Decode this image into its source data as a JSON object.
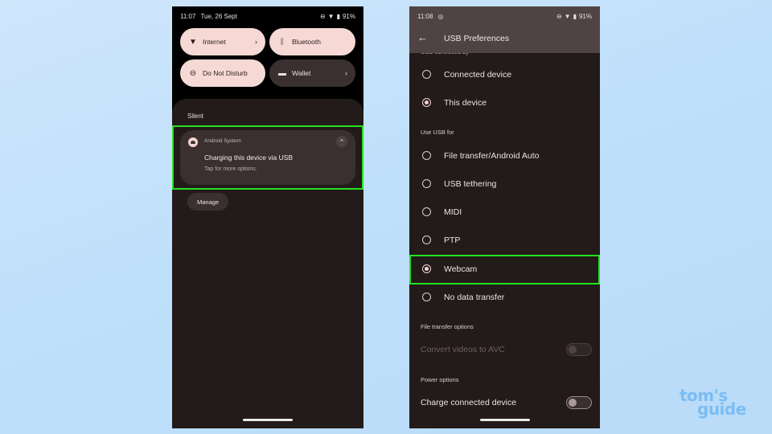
{
  "left_screen": {
    "status_bar": {
      "time": "11:07",
      "date": "Tue, 26 Sept",
      "battery": "91%",
      "icons": [
        "dnd-icon",
        "wifi-icon",
        "battery-icon"
      ]
    },
    "quick_tiles": [
      {
        "label": "Internet",
        "icon": "wifi-icon",
        "state": "on",
        "has_chevron": true
      },
      {
        "label": "Bluetooth",
        "icon": "bluetooth-icon",
        "state": "on",
        "has_chevron": false
      },
      {
        "label": "Do Not Disturb",
        "icon": "dnd-icon",
        "state": "on",
        "has_chevron": false
      },
      {
        "label": "Wallet",
        "icon": "wallet-icon",
        "state": "off",
        "has_chevron": true
      }
    ],
    "chevron": "›",
    "section_label": "Silent",
    "notification": {
      "app_name": "Android System",
      "title": "Charging this device via USB",
      "subtitle": "Tap for more options.",
      "expand_icon": "^"
    },
    "manage_label": "Manage"
  },
  "right_screen": {
    "status_bar": {
      "time": "11:08",
      "battery": "91%",
      "icons": [
        "webcam-status-icon",
        "dnd-icon",
        "wifi-icon",
        "battery-icon"
      ]
    },
    "title": "USB Preferences",
    "back_icon": "←",
    "usb_controlled_by": {
      "header": "USB controlled by",
      "options": [
        {
          "label": "Connected device",
          "selected": false
        },
        {
          "label": "This device",
          "selected": true
        }
      ]
    },
    "use_usb_for": {
      "header": "Use USB for",
      "options": [
        {
          "label": "File transfer/Android Auto",
          "selected": false
        },
        {
          "label": "USB tethering",
          "selected": false
        },
        {
          "label": "MIDI",
          "selected": false
        },
        {
          "label": "PTP",
          "selected": false
        },
        {
          "label": "Webcam",
          "selected": true
        },
        {
          "label": "No data transfer",
          "selected": false
        }
      ]
    },
    "file_transfer_options": {
      "header": "File transfer options",
      "toggle_label": "Convert videos to AVC",
      "enabled": false,
      "on": false
    },
    "power_options": {
      "header": "Power options",
      "toggle_label": "Charge connected device",
      "enabled": true,
      "on": false
    }
  },
  "watermark": {
    "line1": "tom's",
    "line2": "guide"
  },
  "colors": {
    "highlight": "#23e21f",
    "tile_on": "#f6d9d5",
    "accent": "#f4d4d0",
    "surface": "#231a1a"
  }
}
